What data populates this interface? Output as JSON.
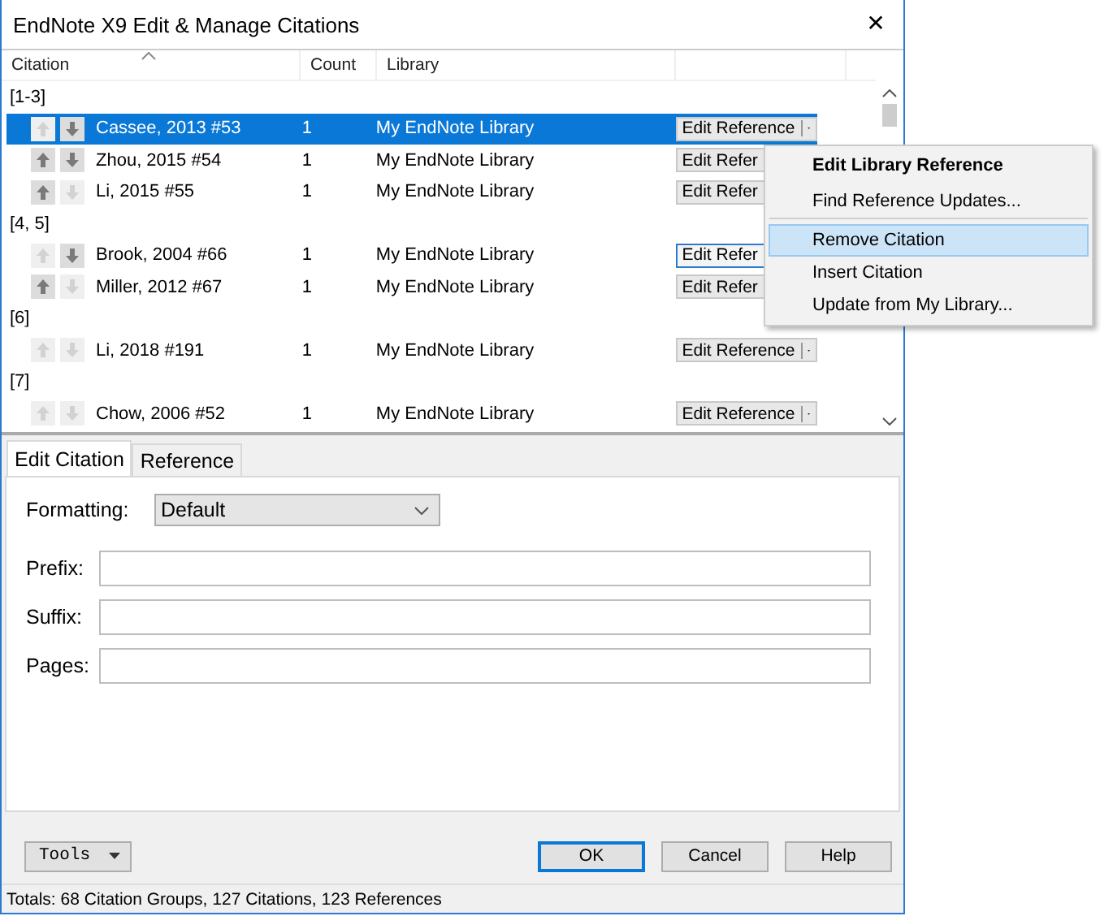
{
  "window": {
    "title": "EndNote X9 Edit & Manage Citations",
    "close": "✕"
  },
  "table": {
    "columns": [
      "Citation",
      "Count",
      "Library"
    ],
    "groups": [
      {
        "label": "[1-3]",
        "rows": [
          {
            "citation": "Cassee, 2013 #53",
            "count": "1",
            "library": "My EndNote Library",
            "selected": true,
            "up_enabled": false,
            "down_enabled": true,
            "button": "Edit Reference",
            "focused": false,
            "has_caret": true
          },
          {
            "citation": "Zhou, 2015 #54",
            "count": "1",
            "library": "My EndNote Library",
            "selected": false,
            "up_enabled": true,
            "down_enabled": true,
            "button": "Edit Refer",
            "focused": false
          },
          {
            "citation": "Li, 2015 #55",
            "count": "1",
            "library": "My EndNote Library",
            "selected": false,
            "up_enabled": true,
            "down_enabled": false,
            "button": "Edit Refer",
            "focused": false
          }
        ]
      },
      {
        "label": "[4, 5]",
        "rows": [
          {
            "citation": "Brook, 2004 #66",
            "count": "1",
            "library": "My EndNote Library",
            "selected": false,
            "up_enabled": false,
            "down_enabled": true,
            "button": "Edit Refer",
            "focused": true
          },
          {
            "citation": "Miller, 2012 #67",
            "count": "1",
            "library": "My EndNote Library",
            "selected": false,
            "up_enabled": true,
            "down_enabled": false,
            "button": "Edit Refer",
            "focused": false
          }
        ]
      },
      {
        "label": "[6]",
        "rows": [
          {
            "citation": "Li, 2018 #191",
            "count": "1",
            "library": "My EndNote Library",
            "selected": false,
            "up_enabled": false,
            "down_enabled": false,
            "button": "Edit Reference",
            "focused": false,
            "has_caret": true
          }
        ]
      },
      {
        "label": "[7]",
        "rows": [
          {
            "citation": "Chow, 2006 #52",
            "count": "1",
            "library": "My EndNote Library",
            "selected": false,
            "up_enabled": false,
            "down_enabled": false,
            "button": "Edit Reference",
            "focused": false,
            "has_caret": true
          }
        ]
      }
    ]
  },
  "context_menu": {
    "items": [
      {
        "label": "Edit Library Reference",
        "default": true,
        "selected": false,
        "separator_after": false
      },
      {
        "label": "Find Reference Updates...",
        "default": false,
        "selected": false,
        "separator_after": true
      },
      {
        "label": "Remove Citation",
        "default": false,
        "selected": true,
        "separator_after": false
      },
      {
        "label": "Insert Citation",
        "default": false,
        "selected": false,
        "separator_after": false
      },
      {
        "label": "Update from My Library...",
        "default": false,
        "selected": false,
        "separator_after": false
      }
    ]
  },
  "tabs": [
    {
      "label": "Edit Citation",
      "selected": true
    },
    {
      "label": "Reference",
      "selected": false
    }
  ],
  "form": {
    "formatting_label": "Formatting:",
    "formatting_value": "Default",
    "fields": [
      {
        "label": "Prefix:"
      },
      {
        "label": "Suffix:"
      },
      {
        "label": "Pages:"
      }
    ]
  },
  "buttons": {
    "tools": "Tools",
    "ok": "OK",
    "cancel": "Cancel",
    "help": "Help"
  },
  "status_bar": "Totals: 68 Citation Groups, 127 Citations, 123 References"
}
